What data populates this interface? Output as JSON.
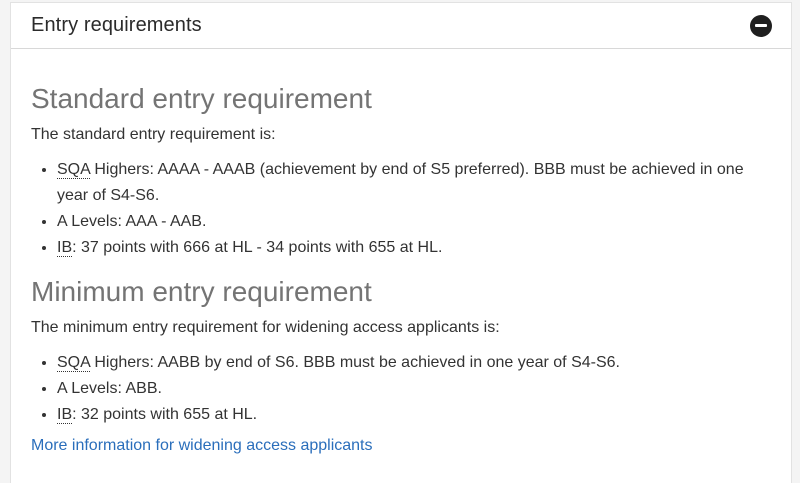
{
  "header": {
    "title": "Entry requirements"
  },
  "standard": {
    "heading": "Standard entry requirement",
    "intro": "The standard entry requirement is:",
    "items": [
      {
        "abbr": "SQA",
        "text": " Highers: AAAA - AAAB (achievement by end of S5 preferred). BBB must be achieved in one year of S4-S6."
      },
      {
        "abbr": "",
        "text": "A Levels: AAA - AAB."
      },
      {
        "abbr": "IB",
        "text": ": 37 points with 666 at HL - 34 points with 655 at HL."
      }
    ]
  },
  "minimum": {
    "heading": "Minimum entry requirement",
    "intro": "The minimum entry requirement for widening access applicants is:",
    "items": [
      {
        "abbr": "SQA",
        "text": " Highers: AABB by end of S6. BBB must be achieved in one year of S4-S6."
      },
      {
        "abbr": "",
        "text": "A Levels: ABB."
      },
      {
        "abbr": "IB",
        "text": ": 32 points with 655 at HL."
      }
    ]
  },
  "link": {
    "label": "More information for widening access applicants"
  },
  "colors": {
    "link": "#2a6ebb",
    "heading": "#747474",
    "text": "#333333"
  },
  "icons": {
    "collapse": "minus-circle-icon"
  }
}
